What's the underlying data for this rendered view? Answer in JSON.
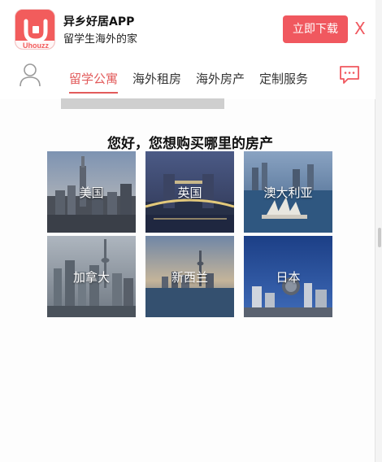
{
  "banner": {
    "logo_text": "Uhouzz",
    "app_name": "异乡好居APP",
    "app_sub": "留学生海外的家",
    "download_label": "立即下载",
    "close_label": "X",
    "accent_color": "#f0585f"
  },
  "nav": {
    "tabs": [
      {
        "label": "留学公寓",
        "active": true
      },
      {
        "label": "海外租房",
        "active": false
      },
      {
        "label": "海外房产",
        "active": false
      },
      {
        "label": "定制服务",
        "active": false
      }
    ]
  },
  "main": {
    "heading": "您好，您想购买哪里的房产",
    "countries": [
      {
        "label": "美国",
        "icon": "new-york-skyline"
      },
      {
        "label": "英国",
        "icon": "tower-bridge"
      },
      {
        "label": "澳大利亚",
        "icon": "sydney-opera-house"
      },
      {
        "label": "加拿大",
        "icon": "toronto-skyline"
      },
      {
        "label": "新西兰",
        "icon": "auckland-harbour"
      },
      {
        "label": "日本",
        "icon": "tokyo-skyline"
      }
    ]
  }
}
